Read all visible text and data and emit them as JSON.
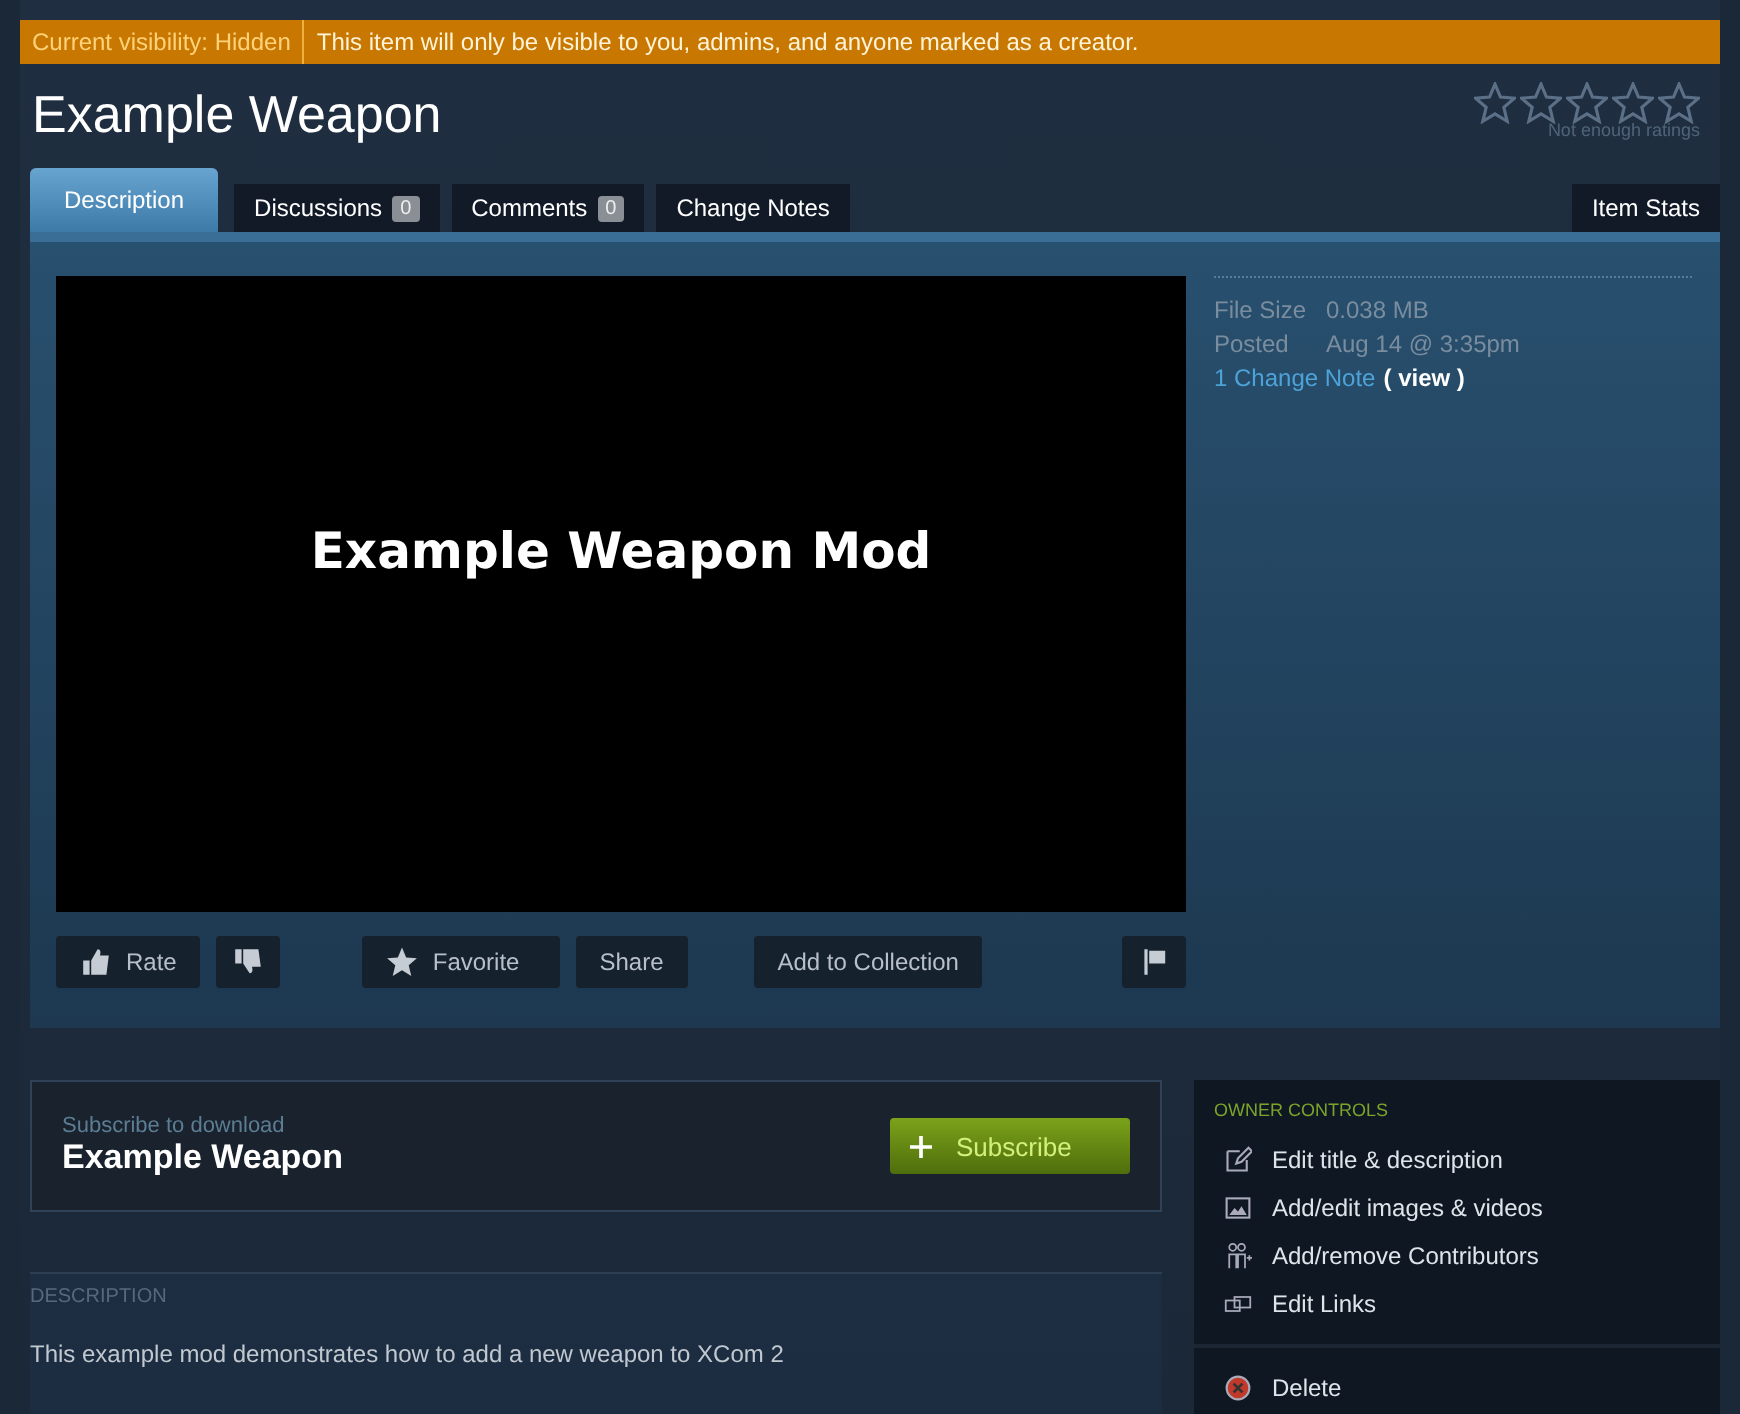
{
  "visibility_bar": {
    "label": "Current visibility: Hidden",
    "message": "This item will only be visible to you, admins, and anyone marked as a creator."
  },
  "title": "Example Weapon",
  "rating": {
    "stars": 0,
    "caption": "Not enough ratings"
  },
  "tabs": [
    {
      "label": "Description",
      "selected": true
    },
    {
      "label": "Discussions",
      "count": "0",
      "selected": false
    },
    {
      "label": "Comments",
      "count": "0",
      "selected": false
    },
    {
      "label": "Change Notes",
      "selected": false
    }
  ],
  "stats_tab": {
    "label": "Item Stats",
    "selected": false
  },
  "preview": {
    "text": "Example Weapon Mod"
  },
  "actions": [
    {
      "kind": "rate",
      "label": "Rate"
    },
    {
      "kind": "thumbs_down"
    },
    {
      "kind": "favorite",
      "label": "Favorite"
    },
    {
      "kind": "plain",
      "label": "Share"
    },
    {
      "kind": "plain",
      "label": "Add to Collection"
    },
    {
      "kind": "flag"
    }
  ],
  "details": [
    {
      "label": "File Size",
      "value": "0.038 MB"
    },
    {
      "label": "Posted",
      "value": "Aug 14 @ 3:35pm"
    }
  ],
  "change_note": {
    "link": "1 Change Note",
    "view": "( view )"
  },
  "subscribe": {
    "caption": "Subscribe to download",
    "name": "Example Weapon",
    "button": "Subscribe"
  },
  "description": {
    "heading": "DESCRIPTION",
    "text": "This example mod demonstrates how to add a new weapon to XCom 2"
  },
  "owner_controls": {
    "heading": "OWNER CONTROLS",
    "items": [
      {
        "kind": "edit",
        "label": "Edit title & description"
      },
      {
        "kind": "images",
        "label": "Add/edit images & videos"
      },
      {
        "kind": "contributors",
        "label": "Add/remove Contributors"
      },
      {
        "kind": "links",
        "label": "Edit Links"
      }
    ],
    "delete": "Delete"
  }
}
